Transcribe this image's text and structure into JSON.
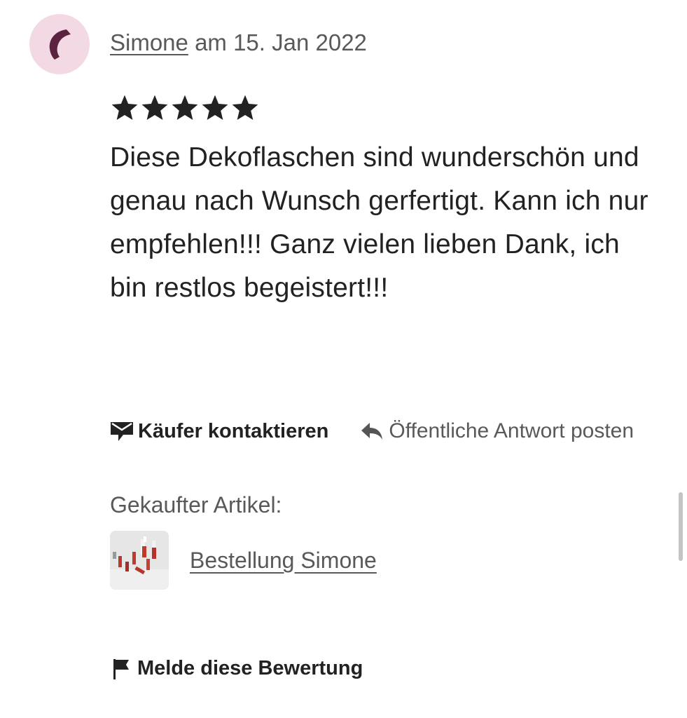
{
  "review": {
    "reviewer_name": "Simone",
    "date_text": "am 15. Jan 2022",
    "rating": 5,
    "rating_max": 5,
    "text": "Diese Dekoflaschen sind wunderschön und genau nach Wunsch gerfertigt. Kann ich nur empfehlen!!! Ganz vielen lieben Dank, ich bin restlos begeistert!!!"
  },
  "actions": {
    "contact_label": "Käufer kontaktieren",
    "reply_label": "Öffentliche Antwort posten"
  },
  "purchased": {
    "label": "Gekaufter Artikel:",
    "item_title": "Bestellung Simone"
  },
  "report": {
    "label": "Melde diese Bewertung"
  },
  "icons": {
    "avatar": "crescent-avatar-icon",
    "star": "star-icon",
    "contact": "envelope-icon",
    "reply": "reply-arrow-icon",
    "report": "flag-icon"
  },
  "colors": {
    "avatar_bg": "#f3d9e4",
    "avatar_glyph": "#5c2340",
    "text_primary": "#222222",
    "text_secondary": "#595959"
  }
}
